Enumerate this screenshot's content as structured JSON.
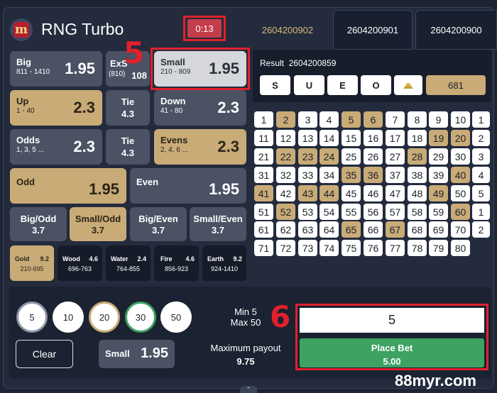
{
  "header": {
    "title": "RNG Turbo",
    "timer": "0:13",
    "rounds": [
      "2604200902",
      "2604200901",
      "2604200900"
    ]
  },
  "annotations": {
    "a5": "5",
    "a6": "6"
  },
  "bets": {
    "big": {
      "label": "Big",
      "range": "811 - 1410",
      "odds": "1.95"
    },
    "exsmall": {
      "label": "ExS",
      "range": "(810)",
      "odds": "108"
    },
    "small": {
      "label": "Small",
      "range": "210 - 809",
      "odds": "1.95"
    },
    "up": {
      "label": "Up",
      "range": "1 - 40",
      "odds": "2.3"
    },
    "tie1": {
      "label": "Tie",
      "odds": "4.3"
    },
    "down": {
      "label": "Down",
      "range": "41 - 80",
      "odds": "2.3"
    },
    "odds": {
      "label": "Odds",
      "range": "1, 3, 5 ...",
      "odds": "2.3"
    },
    "tie2": {
      "label": "Tie",
      "odds": "4.3"
    },
    "evens": {
      "label": "Evens",
      "range": "2, 4, 6 ...",
      "odds": "2.3"
    },
    "odd": {
      "label": "Odd",
      "odds": "1.95"
    },
    "even": {
      "label": "Even",
      "odds": "1.95"
    },
    "big_odd": {
      "label": "Big/Odd",
      "odds": "3.7"
    },
    "small_odd": {
      "label": "Small/Odd",
      "odds": "3.7"
    },
    "big_even": {
      "label": "Big/Even",
      "odds": "3.7"
    },
    "small_even": {
      "label": "Small/Even",
      "odds": "3.7"
    },
    "gold": {
      "label": "Gold",
      "odds": "9.2",
      "range": "210-695"
    },
    "wood": {
      "label": "Wood",
      "odds": "4.6",
      "range": "696-763"
    },
    "water": {
      "label": "Water",
      "odds": "2.4",
      "range": "764-855"
    },
    "fire": {
      "label": "Fire",
      "odds": "4.6",
      "range": "856-923"
    },
    "earth": {
      "label": "Earth",
      "odds": "9.2",
      "range": "924-1410"
    }
  },
  "result": {
    "label": "Result",
    "round": "2604200859",
    "letters": [
      "S",
      "U",
      "E",
      "O"
    ],
    "element_icon": "gold-bars-icon",
    "total": "681"
  },
  "drawn_numbers": [
    2,
    5,
    6,
    19,
    20,
    22,
    23,
    24,
    28,
    35,
    36,
    40,
    41,
    43,
    44,
    49,
    52,
    60,
    65,
    67
  ],
  "row_counts": [
    "1",
    "2",
    "3",
    "4",
    "5",
    "1",
    "2"
  ],
  "chips": [
    "5",
    "10",
    "20",
    "30",
    "50"
  ],
  "bottom": {
    "clear_label": "Clear",
    "selected_bet": "Small",
    "selected_odds": "1.95",
    "min": "Min 5",
    "max": "Max 50",
    "payout_label": "Maximum payout",
    "payout_value": "9.75",
    "bet_amount": "5",
    "place_bet_label": "Place Bet",
    "place_bet_amount": "5.00"
  },
  "watermark": "88myr.com"
}
